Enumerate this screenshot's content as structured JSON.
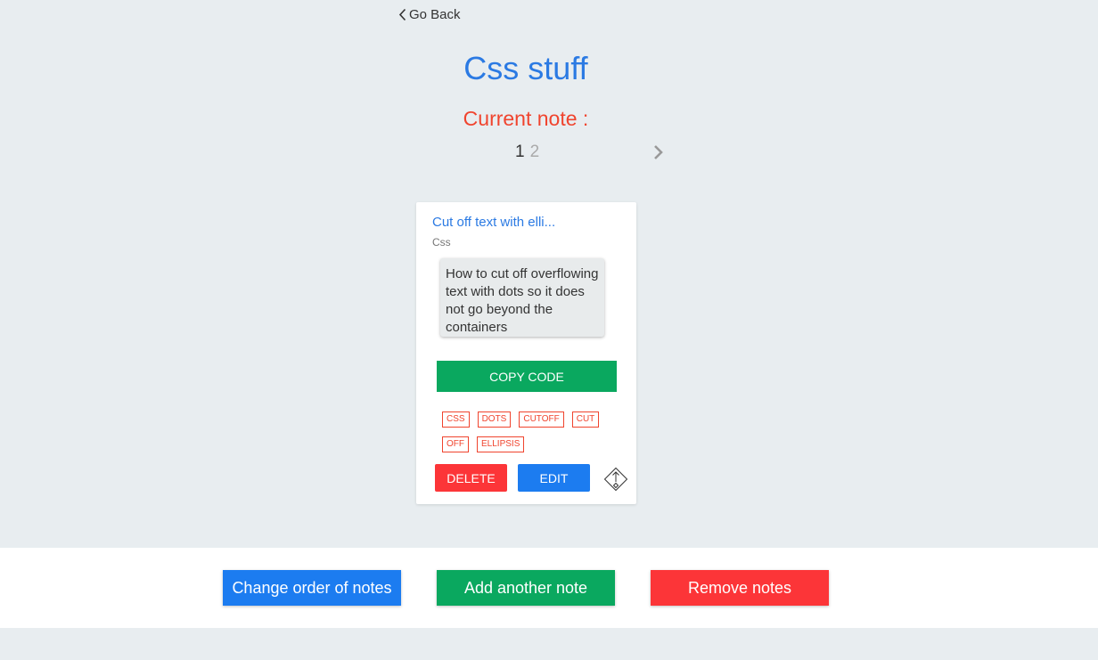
{
  "nav": {
    "go_back_label": "Go Back"
  },
  "page": {
    "title": "Css stuff",
    "current_note_label": "Current note :"
  },
  "pager": {
    "pages": [
      "1",
      "2"
    ],
    "active_page": "1"
  },
  "note_card": {
    "title": "Cut off text with elli...",
    "category": "Css",
    "description": "How to cut off overflowing text with dots so it does not go beyond the containers",
    "copy_button_label": "COPY CODE",
    "tags": [
      "CSS",
      "DOTS",
      "CUTOFF",
      "CUT",
      "OFF",
      "ELLIPSIS"
    ],
    "delete_label": "DELETE",
    "edit_label": "EDIT"
  },
  "bottom_bar": {
    "change_order_label": "Change order of notes",
    "add_note_label": "Add another note",
    "remove_notes_label": "Remove notes"
  },
  "colors": {
    "background": "#e8edf0",
    "title_blue": "#2b7ae3",
    "accent_red": "#f0442e",
    "button_green": "#0aa85f",
    "button_blue": "#1c7cf0",
    "button_red": "#fc3538"
  },
  "icons": {
    "back": "chevron-left-icon",
    "next": "chevron-right-icon",
    "move": "move-arrows-icon"
  }
}
